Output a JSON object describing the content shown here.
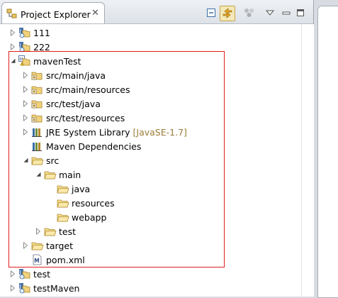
{
  "panel": {
    "tab_title": "Project Explorer",
    "tab_close": "✕",
    "toolbar": [
      {
        "name": "collapse-all-button",
        "icon": "collapse-all-icon"
      },
      {
        "name": "link-with-editor-button",
        "icon": "link-with-editor-icon",
        "pressed": true
      },
      {
        "name": "filters-button",
        "icon": "filters-icon"
      },
      {
        "name": "view-menu-button",
        "icon": "view-menu-icon"
      },
      {
        "name": "minimize-button",
        "icon": "minimize-icon"
      },
      {
        "name": "maximize-button",
        "icon": "maximize-icon"
      }
    ]
  },
  "tree": [
    {
      "label": "111",
      "icon": "java-project-icon",
      "depth": 0,
      "toggle": "collapsed"
    },
    {
      "label": "222",
      "icon": "java-project-icon",
      "depth": 0,
      "toggle": "collapsed"
    },
    {
      "label": "mavenTest",
      "icon": "maven-project-icon",
      "depth": 0,
      "toggle": "expanded"
    },
    {
      "label": "src/main/java",
      "icon": "source-folder-icon",
      "depth": 1,
      "toggle": "collapsed"
    },
    {
      "label": "src/main/resources",
      "icon": "source-folder-icon",
      "depth": 1,
      "toggle": "collapsed"
    },
    {
      "label": "src/test/java",
      "icon": "source-folder-icon",
      "depth": 1,
      "toggle": "collapsed"
    },
    {
      "label": "src/test/resources",
      "icon": "source-folder-icon",
      "depth": 1,
      "toggle": "collapsed"
    },
    {
      "label": "JRE System Library",
      "decoration": "[JavaSE-1.7]",
      "icon": "library-icon",
      "depth": 1,
      "toggle": "collapsed"
    },
    {
      "label": "Maven Dependencies",
      "icon": "library-icon",
      "depth": 1,
      "toggle": "none"
    },
    {
      "label": "src",
      "icon": "folder-icon",
      "depth": 1,
      "toggle": "expanded"
    },
    {
      "label": "main",
      "icon": "folder-icon",
      "depth": 2,
      "toggle": "expanded"
    },
    {
      "label": "java",
      "icon": "folder-icon",
      "depth": 3,
      "toggle": "none"
    },
    {
      "label": "resources",
      "icon": "folder-icon",
      "depth": 3,
      "toggle": "none"
    },
    {
      "label": "webapp",
      "icon": "folder-icon",
      "depth": 3,
      "toggle": "none"
    },
    {
      "label": "test",
      "icon": "folder-icon",
      "depth": 2,
      "toggle": "collapsed"
    },
    {
      "label": "target",
      "icon": "folder-icon",
      "depth": 1,
      "toggle": "collapsed"
    },
    {
      "label": "pom.xml",
      "icon": "maven-file-icon",
      "depth": 1,
      "toggle": "none"
    },
    {
      "label": "test",
      "icon": "java-project-icon",
      "depth": 0,
      "toggle": "collapsed"
    },
    {
      "label": "testMaven",
      "icon": "java-project-icon",
      "depth": 0,
      "toggle": "collapsed"
    }
  ],
  "colors": {
    "highlight_box": "#e01c1c",
    "decoration": "#9a7b35"
  }
}
